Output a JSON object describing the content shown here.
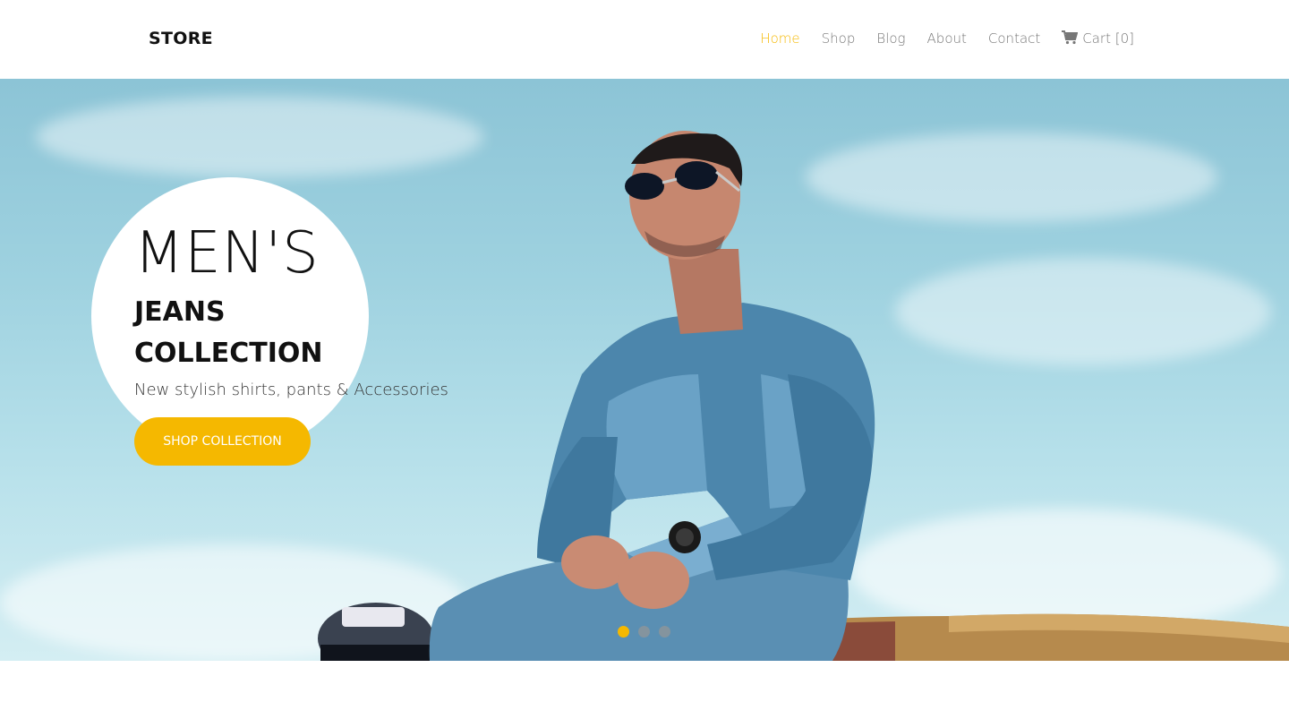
{
  "header": {
    "brand": "STORE",
    "nav": [
      {
        "label": "Home",
        "active": true
      },
      {
        "label": "Shop",
        "active": false
      },
      {
        "label": "Blog",
        "active": false
      },
      {
        "label": "About",
        "active": false
      },
      {
        "label": "Contact",
        "active": false
      }
    ],
    "cart_label": "Cart [0]"
  },
  "hero": {
    "title": "MEN'S",
    "subtitle_line1": "JEANS",
    "subtitle_line2": "COLLECTION",
    "description": "New stylish shirts, pants & Accessories",
    "cta_label": "SHOP COLLECTION",
    "slides_total": 3,
    "active_slide": 1
  },
  "colors": {
    "accent": "#f5b800",
    "text": "#111111",
    "nav_text": "#777777"
  },
  "icons": {
    "cart": "shopping-cart-icon"
  }
}
